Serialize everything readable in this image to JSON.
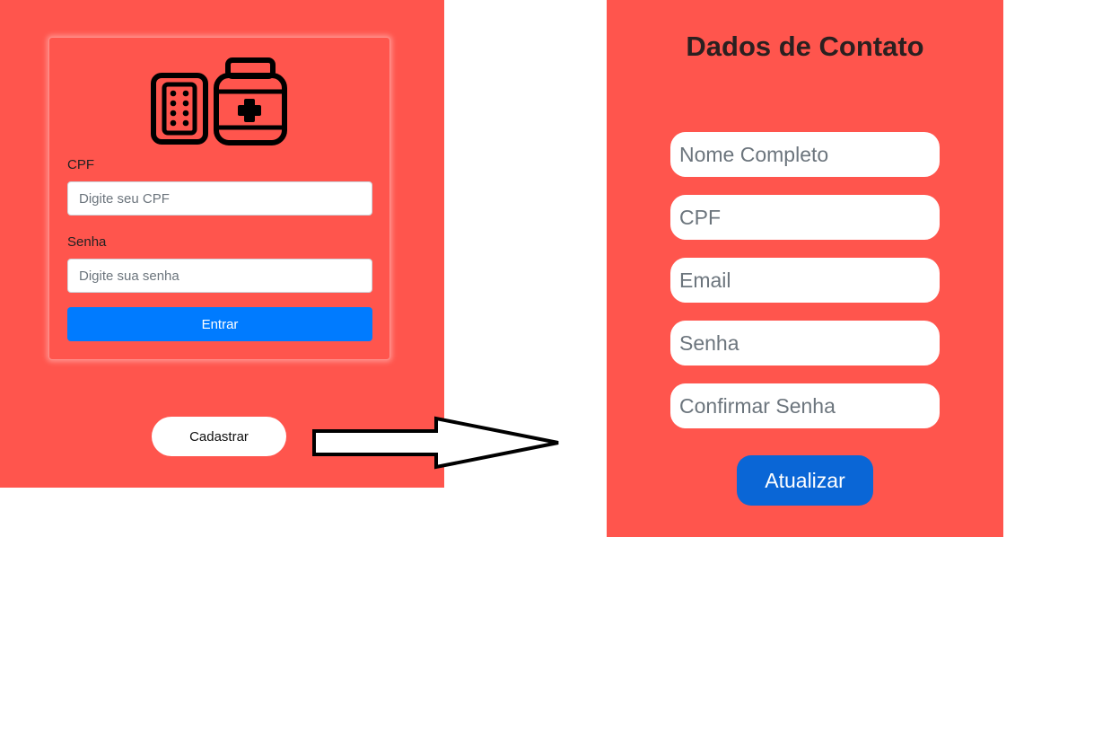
{
  "login": {
    "logo_icon": "pills-and-medicine-bottle-icon",
    "cpf_label": "CPF",
    "cpf_placeholder": "Digite seu CPF",
    "senha_label": "Senha",
    "senha_placeholder": "Digite sua senha",
    "entrar_label": "Entrar",
    "cadastrar_label": "Cadastrar"
  },
  "arrow_icon": "right-arrow-icon",
  "contact": {
    "title": "Dados de Contato",
    "fields": [
      {
        "placeholder": "Nome Completo"
      },
      {
        "placeholder": "CPF"
      },
      {
        "placeholder": "Email"
      },
      {
        "placeholder": "Senha"
      },
      {
        "placeholder": "Confirmar Senha"
      }
    ],
    "atualizar_label": "Atualizar"
  },
  "colors": {
    "panel_bg": "#ff554d",
    "primary_button": "#007bff",
    "update_button": "#0a66d6"
  }
}
